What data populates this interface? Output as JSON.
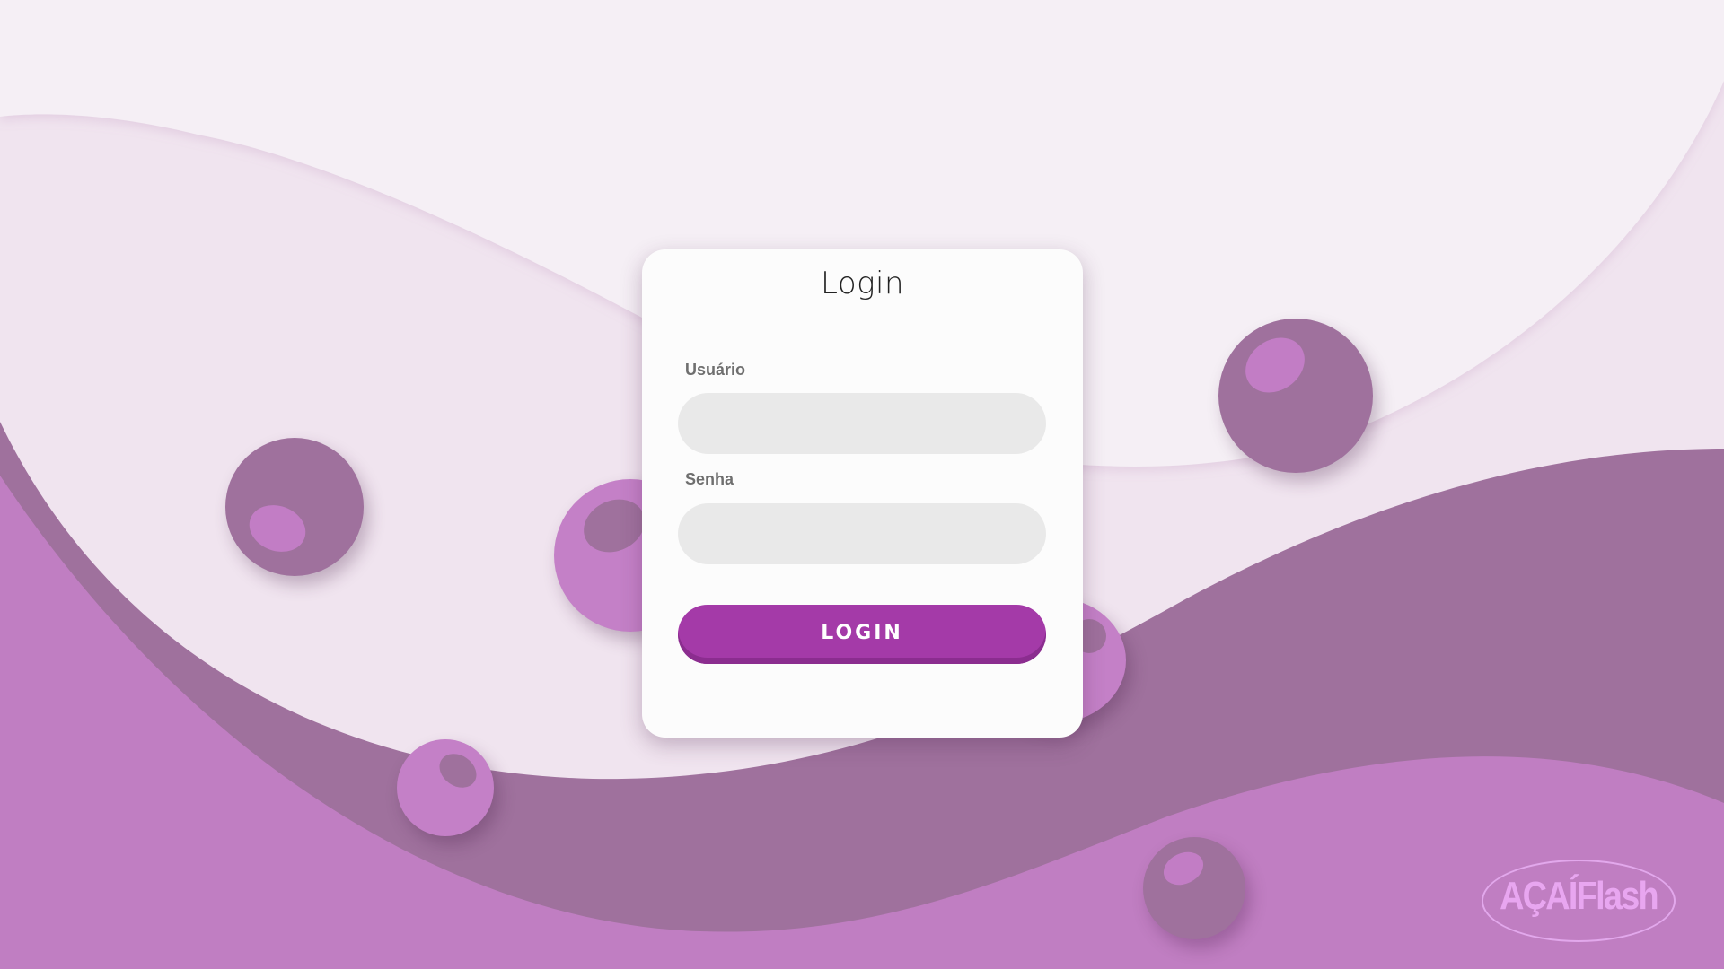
{
  "login": {
    "title": "Login",
    "username_label": "Usuário",
    "username_value": "",
    "password_label": "Senha",
    "password_value": "",
    "button_label": "LOGIN"
  },
  "brand": {
    "name": "AÇAÍFlash"
  },
  "colors": {
    "background": "#f0e4ef",
    "light_bubble": "#f5f0f5",
    "dark_wave": "#9f719d",
    "light_wave": "#c07ec2",
    "button": "#a43aa8",
    "input": "#e9e9e9",
    "logo": "#e8a6f0"
  }
}
